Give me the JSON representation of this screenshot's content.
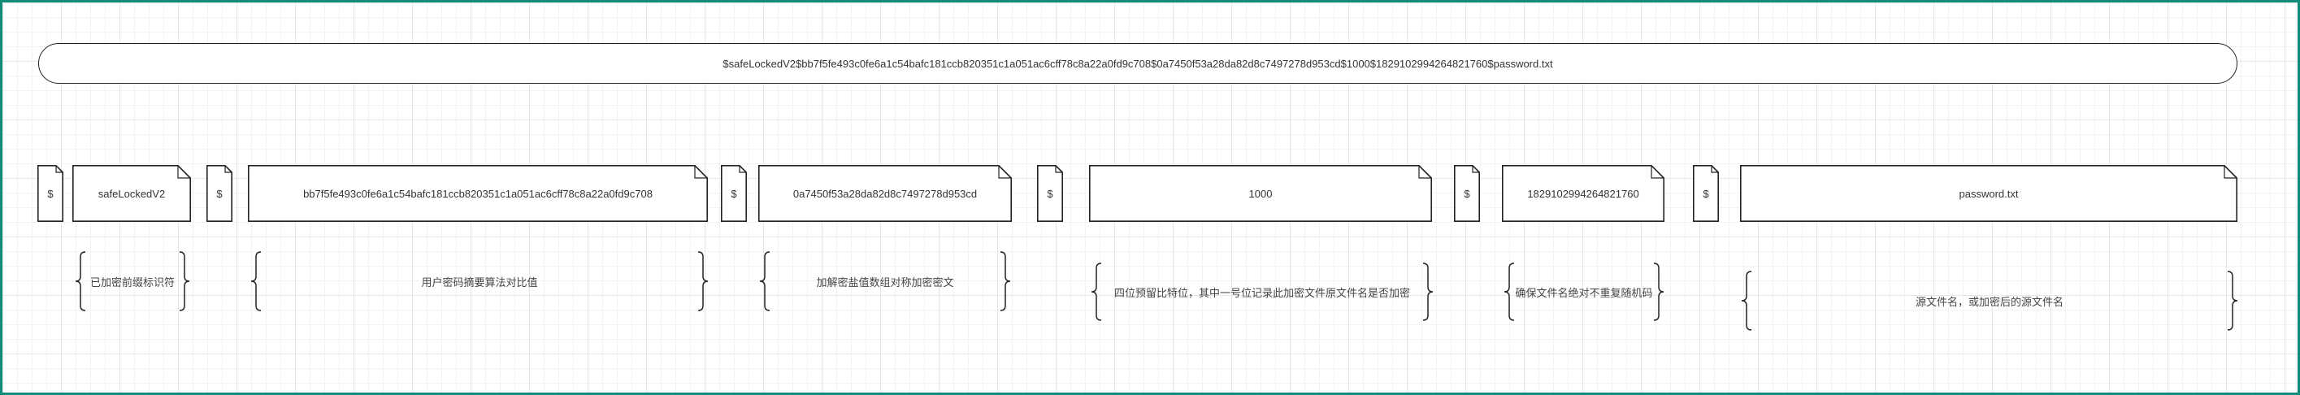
{
  "header": "$safeLockedV2$bb7f5fe493c0fe6a1c54bafc181ccb820351c1a051ac6cff78c8a22a0fd9c708$0a7450f53a28da82d8c7497278d953cd$1000$1829102994264821760$password.txt",
  "segments": {
    "sep1": "$",
    "prefix": "safeLockedV2",
    "sep2": "$",
    "hash": "bb7f5fe493c0fe6a1c54bafc181ccb820351c1a051ac6cff78c8a22a0fd9c708",
    "sep3": "$",
    "salt": "0a7450f53a28da82d8c7497278d953cd",
    "sep4": "$",
    "flags": "1000",
    "sep5": "$",
    "random_id": "1829102994264821760",
    "sep6": "$",
    "filename": "password.txt"
  },
  "annotations": {
    "prefix": "已加密前缀标识符",
    "hash": "用户密码摘要算法对比值",
    "salt": "加解密盐值数组对称加密密文",
    "flags": "四位预留比特位，其中一号位记录此加密文件原文件名是否加密",
    "random_id": "确保文件名绝对不重复随机码",
    "filename": "源文件名，或加密后的源文件名"
  }
}
